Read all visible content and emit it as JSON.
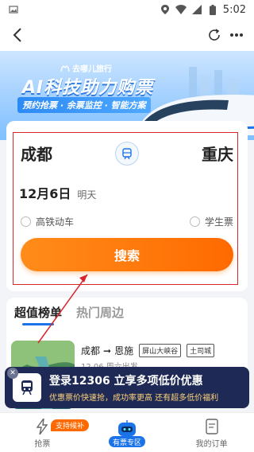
{
  "status_bar": {
    "time": "5:02"
  },
  "hero": {
    "brand": "去哪儿旅行",
    "headline": "AI科技助力购票",
    "subline": "预约抢票 · 余票监控 · 智能方案"
  },
  "search": {
    "from_station": "成都",
    "to_station": "重庆",
    "date": "12月6日",
    "date_hint": "明天",
    "option_high_speed": "高铁动车",
    "option_student": "学生票",
    "search_button": "搜索"
  },
  "tabs": [
    {
      "label": "超值榜单",
      "active": true
    },
    {
      "label": "热门周边",
      "active": false
    }
  ],
  "route": {
    "from": "成都",
    "to": "恩施",
    "tags": [
      "屏山大峡谷",
      "土司城"
    ],
    "date_partial": "12.06 周六出发"
  },
  "promo": {
    "title": "登录12306 立享多项低价优惠",
    "subtitle": "优惠票价快速抢，成功率更高 还有超多低价福利"
  },
  "bottom_nav": {
    "grab_ticket": "抢票",
    "grab_badge": "支持候补",
    "ticket_zone": "有票专区",
    "my_orders": "我的订单"
  },
  "colors": {
    "accent_orange": "#ff6a00",
    "accent_blue": "#1a73e8",
    "annotation_red": "#d9262c",
    "promo_bg": "#1e2a55"
  }
}
